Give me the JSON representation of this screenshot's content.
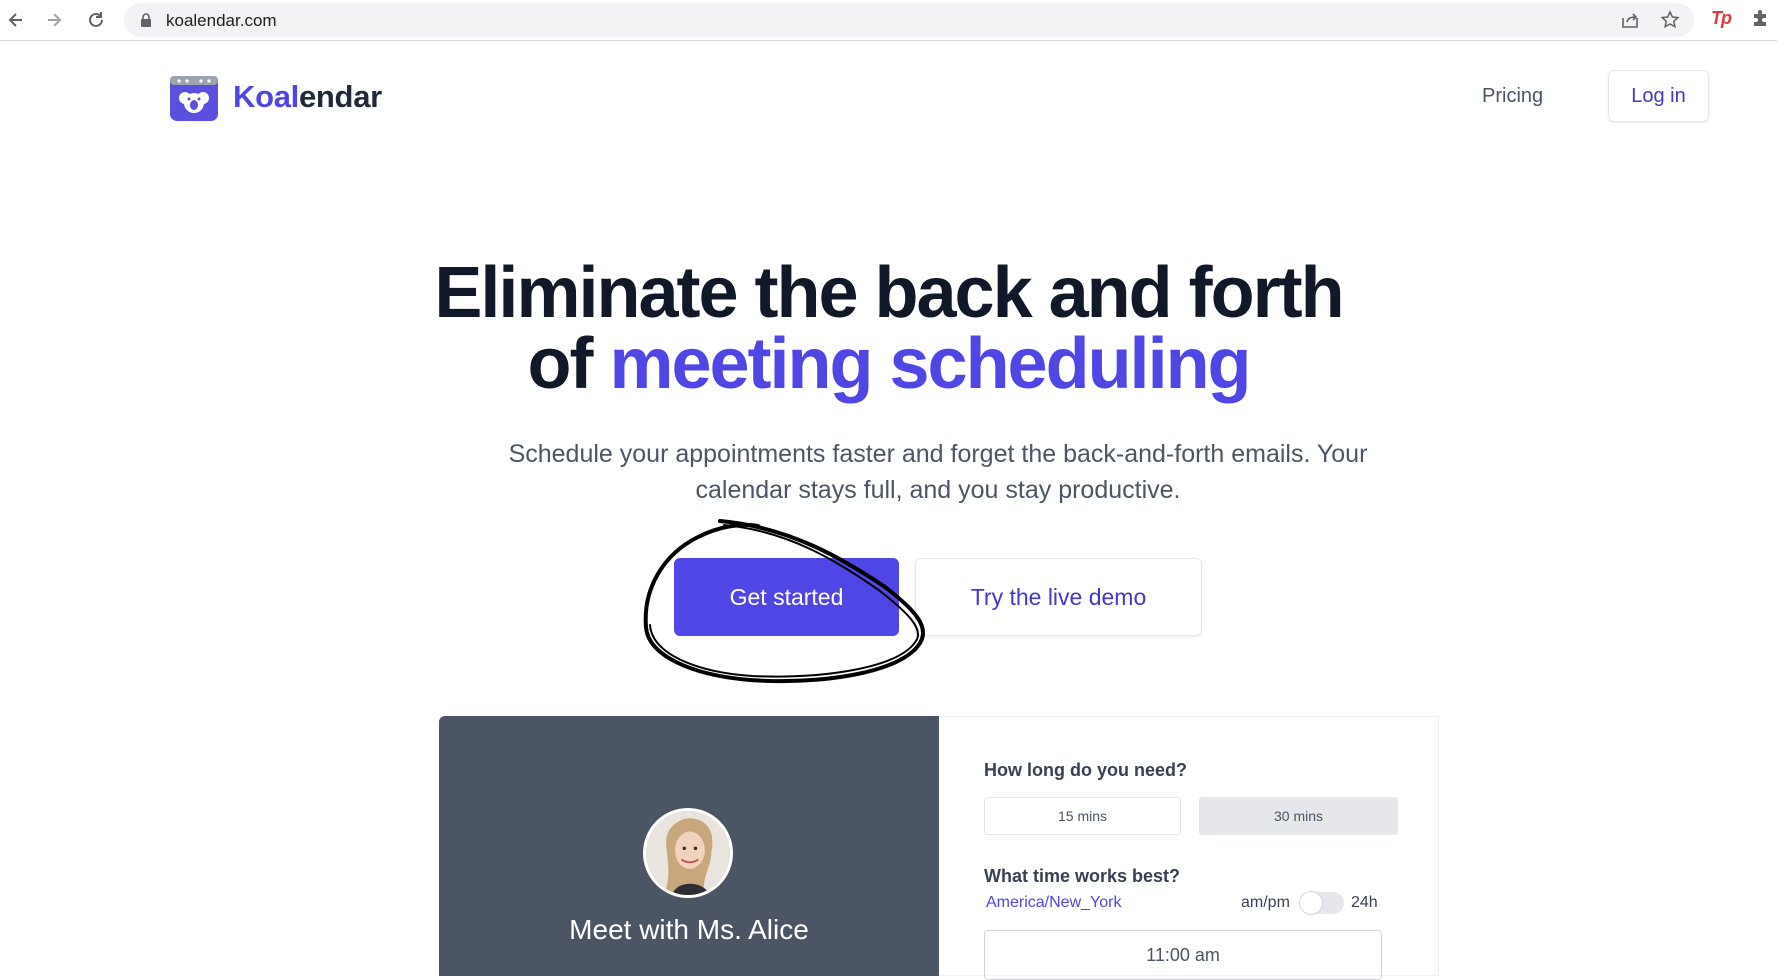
{
  "browser": {
    "url": "koalendar.com",
    "icons": [
      "back-arrow-icon",
      "forward-arrow-icon",
      "reload-icon",
      "lock-icon",
      "share-icon",
      "bookmark-star-icon",
      "tp-extension-icon",
      "extensions-puzzle-icon"
    ],
    "extension_label": "Tp"
  },
  "site": {
    "brand_part1": "Koal",
    "brand_part2": "endar",
    "nav": {
      "pricing": "Pricing",
      "login": "Log in"
    }
  },
  "hero": {
    "headline_line1": "Eliminate the back and forth",
    "headline_line2_prefix": "of ",
    "headline_line2_accent": "meeting scheduling",
    "subtext": "Schedule your appointments faster and forget the back-and-forth emails. Your calendar stays full, and you stay productive.",
    "primary_cta": "Get started",
    "secondary_cta": "Try the live demo"
  },
  "demo": {
    "meet_title": "Meet with Ms. Alice",
    "duration_question": "How long do you need?",
    "durations": [
      {
        "label": "15 mins",
        "selected": false
      },
      {
        "label": "30 mins",
        "selected": true
      }
    ],
    "time_question": "What time works best?",
    "timezone": "America/New_York",
    "format_ampm": "am/pm",
    "format_24h": "24h",
    "format_24h_enabled": false,
    "first_slot": "11:00 am"
  },
  "colors": {
    "brand_indigo": "#4f46e5",
    "heading_dark": "#111827",
    "widget_dark_panel": "#4b5563"
  }
}
